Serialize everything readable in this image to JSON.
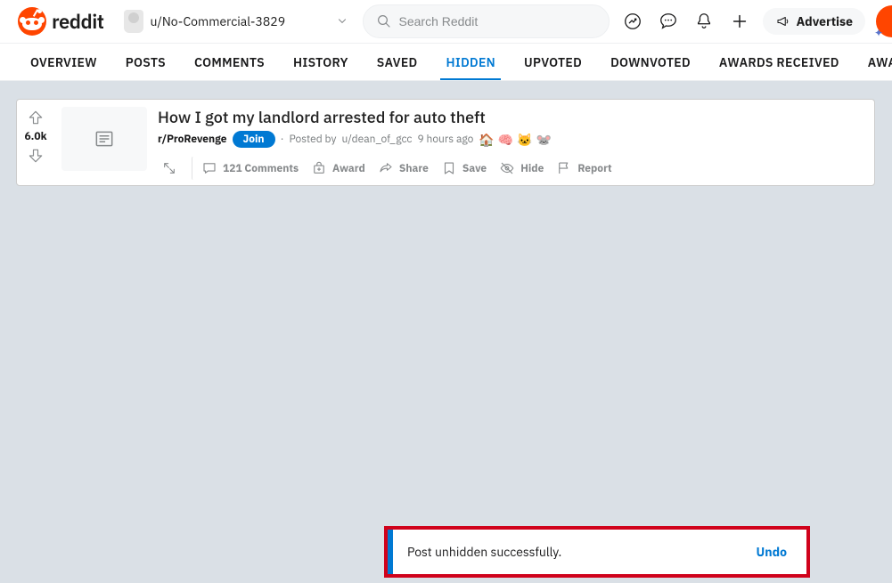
{
  "header": {
    "brand": "reddit",
    "location": "u/No-Commercial-3829",
    "search_placeholder": "Search Reddit",
    "advertise": "Advertise"
  },
  "tabs": [
    {
      "id": "overview",
      "label": "OVERVIEW",
      "active": false
    },
    {
      "id": "posts",
      "label": "POSTS",
      "active": false
    },
    {
      "id": "comments",
      "label": "COMMENTS",
      "active": false
    },
    {
      "id": "history",
      "label": "HISTORY",
      "active": false
    },
    {
      "id": "saved",
      "label": "SAVED",
      "active": false
    },
    {
      "id": "hidden",
      "label": "HIDDEN",
      "active": true
    },
    {
      "id": "upvoted",
      "label": "UPVOTED",
      "active": false
    },
    {
      "id": "downvoted",
      "label": "DOWNVOTED",
      "active": false
    },
    {
      "id": "awards_received",
      "label": "AWARDS RECEIVED",
      "active": false
    },
    {
      "id": "awards_given",
      "label": "AWARDS GIVEN",
      "active": false
    }
  ],
  "post": {
    "score": "6.0k",
    "title": "How I got my landlord arrested for auto theft",
    "subreddit": "r/ProRevenge",
    "join": "Join",
    "posted_by_prefix": "Posted by",
    "author": "u/dean_of_gcc",
    "age": "9 hours ago",
    "award_emojis": [
      "🏠",
      "🧠",
      "🐱",
      "🐭"
    ],
    "actions": {
      "comments": "121 Comments",
      "award": "Award",
      "share": "Share",
      "save": "Save",
      "hide": "Hide",
      "report": "Report"
    }
  },
  "toast": {
    "message": "Post unhidden successfully.",
    "action": "Undo"
  }
}
